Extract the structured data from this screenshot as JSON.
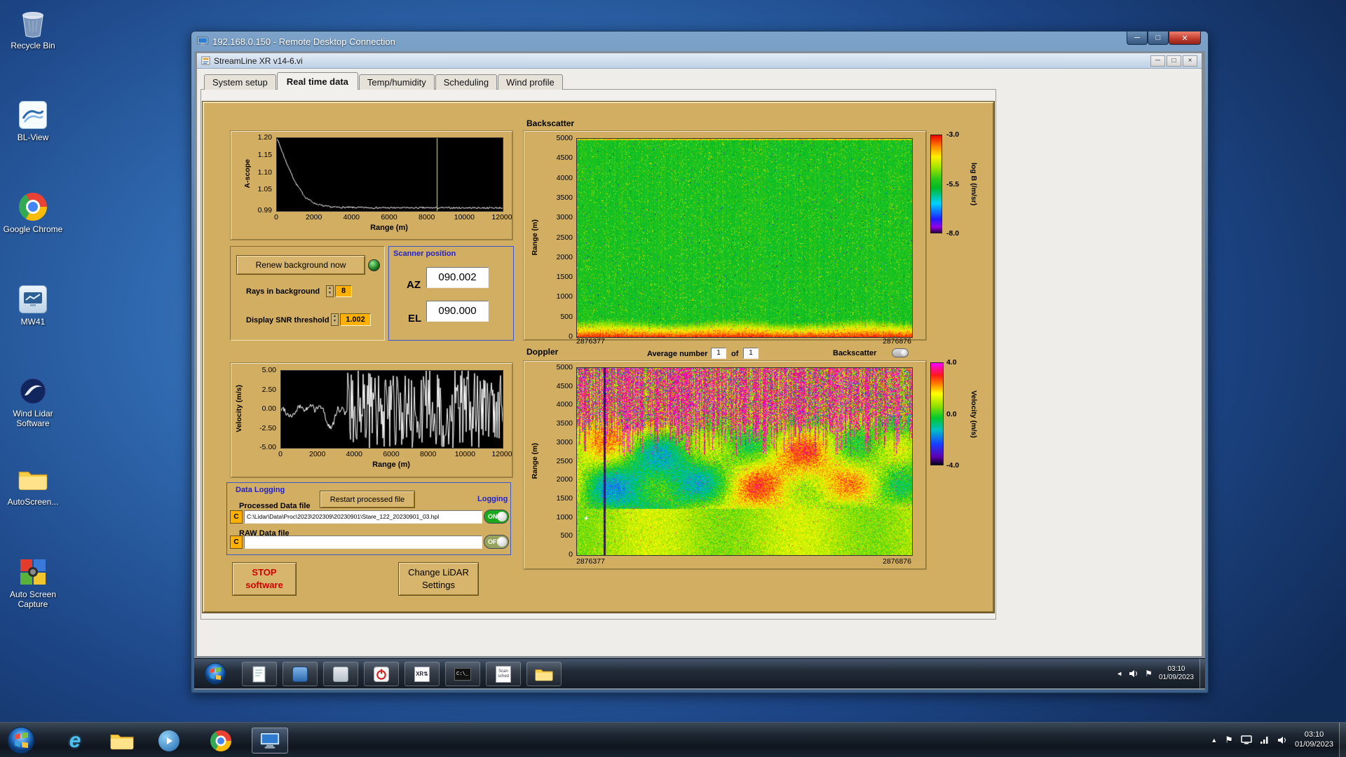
{
  "desktop": {
    "icons": [
      {
        "label": "Recycle Bin"
      },
      {
        "label": "BL-View"
      },
      {
        "label": "Google Chrome"
      },
      {
        "label": "MW41"
      },
      {
        "label": "Wind Lidar Software"
      },
      {
        "label": "AutoScreen..."
      },
      {
        "label": "Auto Screen Capture"
      }
    ]
  },
  "rdc": {
    "title": "192.168.0.150 - Remote Desktop Connection"
  },
  "app": {
    "title": "StreamLine XR v14-6.vi",
    "active_tab": "Real time data",
    "tabs": [
      {
        "label": "System setup"
      },
      {
        "label": "Real time data"
      },
      {
        "label": "Temp/humidity"
      },
      {
        "label": "Scheduling"
      },
      {
        "label": "Wind profile"
      }
    ]
  },
  "panel": {
    "backscatter_title": "Backscatter",
    "doppler_title": "Doppler",
    "renew_button_label": "Renew background now",
    "rays_label": "Rays in background",
    "rays_value": "8",
    "snr_label": "Display SNR threshold",
    "snr_value": "1.002",
    "scanner": {
      "title": "Scanner position",
      "az_label": "AZ",
      "az_value": "090.002",
      "el_label": "EL",
      "el_value": "090.000"
    },
    "average_label": "Average number",
    "average_value": "1",
    "of_label": "of",
    "average_total": "1",
    "backscatter_toggle_label": "Backscatter",
    "logging": {
      "title": "Data Logging",
      "processed_label": "Processed Data file",
      "restart_button_label": "Restart processed file",
      "logging_label": "Logging",
      "drive_label": "C",
      "processed_path": "C:\\Lidar\\Data\\Proc\\2023\\202309\\20230901\\Stare_122_20230901_03.hpl",
      "raw_label": "RAW Data file",
      "raw_path": "",
      "on_label": "ON",
      "off_label": "OFF"
    },
    "stop_button_label": "STOP\nsoftware",
    "change_button_label": "Change LiDAR\nSettings"
  },
  "remote_taskbar": {
    "clock_time": "03:10",
    "clock_date": "01/09/2023"
  },
  "host_taskbar": {
    "clock_time": "03:10",
    "clock_date": "01/09/2023"
  },
  "chart_data": [
    {
      "id": "a-scope",
      "type": "line",
      "title": "",
      "ylabel": "A-scope",
      "xlabel": "Range (m)",
      "xlim": [
        0,
        12000
      ],
      "ylim": [
        0.99,
        1.2
      ],
      "xticks": [
        "0",
        "2000",
        "4000",
        "6000",
        "8000",
        "10000",
        "12000"
      ],
      "yticks": [
        "1.20",
        "1.15",
        "1.10",
        "1.05",
        "0.99"
      ],
      "x": [
        0,
        250,
        500,
        750,
        1000,
        1500,
        2000,
        2500,
        3000,
        4000,
        6000,
        8000,
        10000,
        12000
      ],
      "y": [
        1.2,
        1.165,
        1.13,
        1.1,
        1.07,
        1.03,
        1.012,
        1.004,
        1.001,
        1.0,
        0.999,
        0.999,
        0.999,
        0.999
      ],
      "cursor_x": 8500,
      "line_color": "#ffffff",
      "cursor_color": "#f2ef5a",
      "plot_bg": "#000000",
      "description": "Background A-scope trace decaying from 1.20 at 0 m to a ~1.00 noise floor beyond ~2500 m, vertical yellow cursor near 8500 m"
    },
    {
      "id": "backscatter-heatmap",
      "type": "heatmap",
      "title": "Backscatter",
      "ylabel": "Range (m)",
      "ylim": [
        0,
        5000
      ],
      "yticks": [
        "5000",
        "4500",
        "4000",
        "3500",
        "3000",
        "2500",
        "2000",
        "1500",
        "1000",
        "500",
        "0"
      ],
      "x_start": "2876377",
      "x_end": "2876876",
      "colorbar": {
        "label": "log B (/m/sr)",
        "min": -8.0,
        "max": -3.0,
        "ticks": [
          "-3.0",
          "-5.5",
          "-8.0"
        ]
      },
      "field": {
        "description": "Attenuated backscatter time-height section: strong aerosol layer (log B ~ -3.2 red/orange/yellow) below ~500 m, speckled clear-air green (log B ~ -5.5) from 500 m up to 5000 m",
        "surface_layer_top_m": 500,
        "surface_layer_value": -3.2,
        "background_value": -5.5
      }
    },
    {
      "id": "velocity-a-scope",
      "type": "line",
      "title": "",
      "ylabel": "Velocity (m/s)",
      "xlabel": "Range (m)",
      "xlim": [
        0,
        12000
      ],
      "ylim": [
        -5.0,
        5.0
      ],
      "xticks": [
        "0",
        "2000",
        "4000",
        "6000",
        "8000",
        "10000",
        "12000"
      ],
      "yticks": [
        "5.00",
        "2.50",
        "0.00",
        "-2.50",
        "-5.00"
      ],
      "profile": {
        "description": "Radial velocity vs range: coherent ~0 +/-1 m/s signal below ~3600 m with a downward excursion near 2600 m, uncorrelated +/-5 m/s noise spikes beyond",
        "signal_range_m": 3600,
        "signal_amplitude": 1.0,
        "noise_amplitude": 5.0
      },
      "line_color": "#ffffff",
      "plot_bg": "#000000"
    },
    {
      "id": "doppler-heatmap",
      "type": "heatmap",
      "title": "Doppler",
      "ylabel": "Range (m)",
      "ylim": [
        0,
        5000
      ],
      "yticks": [
        "5000",
        "4500",
        "4000",
        "3500",
        "3000",
        "2500",
        "2000",
        "1500",
        "1000",
        "500",
        "0"
      ],
      "x_start": "2876377",
      "x_end": "2876876",
      "colorbar": {
        "label": "Velocity (m/s)",
        "min": -4.0,
        "max": 4.0,
        "ticks": [
          "4.0",
          "0.0",
          "-4.0"
        ]
      },
      "field": {
        "description": "Doppler velocity time-height section: yellow/green coherent structures +/-3 m/s with red and blue patches below ~3500 m, saturated magenta noise streaks above the signal top, dark full-height streak near the left edge",
        "noise_floor_top_m": 3500,
        "typical_velocity": 1.0
      }
    }
  ]
}
